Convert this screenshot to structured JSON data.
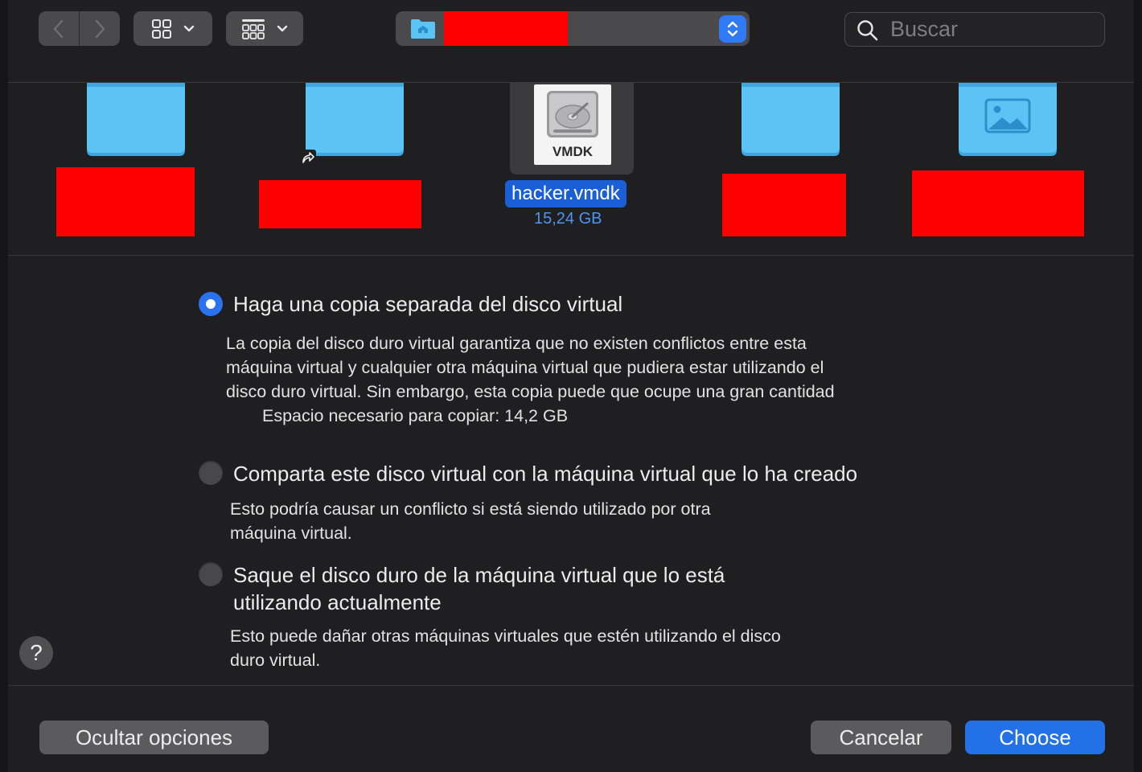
{
  "toolbar": {
    "back_icon": "chevron-left-icon",
    "forward_icon": "chevron-right-icon",
    "view_icon": "icon-grid-icon",
    "group_icon": "group-grid-icon",
    "path_folder_icon": "home-folder-icon",
    "search": {
      "placeholder": "Buscar"
    }
  },
  "browser": {
    "selected_file": {
      "name": "hacker.vmdk",
      "size": "15,24 GB",
      "badge": "VMDK"
    }
  },
  "options": {
    "items": [
      {
        "title": "Haga una copia separada del disco virtual",
        "desc_lines": [
          "La copia del disco duro virtual garantiza que no existen conflictos entre esta",
          "máquina virtual y cualquier otra máquina virtual que pudiera estar utilizando el",
          "disco duro virtual.  Sin embargo, esta copia puede que ocupe una gran cantidad",
          "Espacio necesario para copiar: 14,2 GB"
        ],
        "selected": true
      },
      {
        "title": "Comparta este disco virtual con la máquina virtual que lo ha creado",
        "desc_lines": [
          "Esto podría causar un conflicto si está siendo utilizado por otra",
          "máquina virtual."
        ],
        "selected": false
      },
      {
        "title_lines": [
          "Saque el disco duro de la máquina virtual que lo está",
          "utilizando actualmente"
        ],
        "desc_lines": [
          "Esto puede dañar otras máquinas virtuales que estén utilizando el disco",
          "duro virtual."
        ],
        "selected": false
      }
    ]
  },
  "help": {
    "label": "?"
  },
  "footer": {
    "hide_options": "Ocultar opciones",
    "cancel": "Cancelar",
    "choose": "Choose"
  },
  "colors": {
    "accent": "#2271e6",
    "redaction": "#ff0000",
    "folder": "#5bc4f5"
  }
}
